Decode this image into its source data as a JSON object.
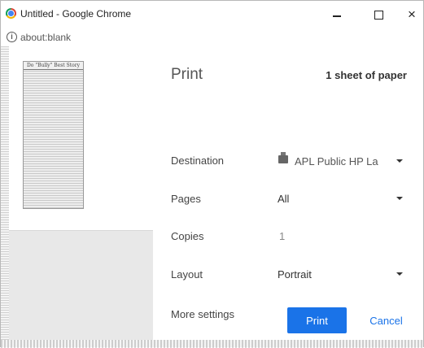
{
  "window": {
    "title": "Untitled - Google Chrome"
  },
  "address": {
    "url": "about:blank"
  },
  "preview": {
    "heading": "Do \"Bully\" Best Story"
  },
  "print": {
    "title": "Print",
    "sheet_count": "1 sheet of paper",
    "destination_label": "Destination",
    "destination_value": "APL Public HP La",
    "pages_label": "Pages",
    "pages_value": "All",
    "copies_label": "Copies",
    "copies_value": "1",
    "layout_label": "Layout",
    "layout_value": "Portrait",
    "more_settings_label": "More settings",
    "print_button": "Print",
    "cancel_button": "Cancel"
  },
  "colors": {
    "accent": "#1a73e8",
    "page_background": "#e8e8e8"
  }
}
